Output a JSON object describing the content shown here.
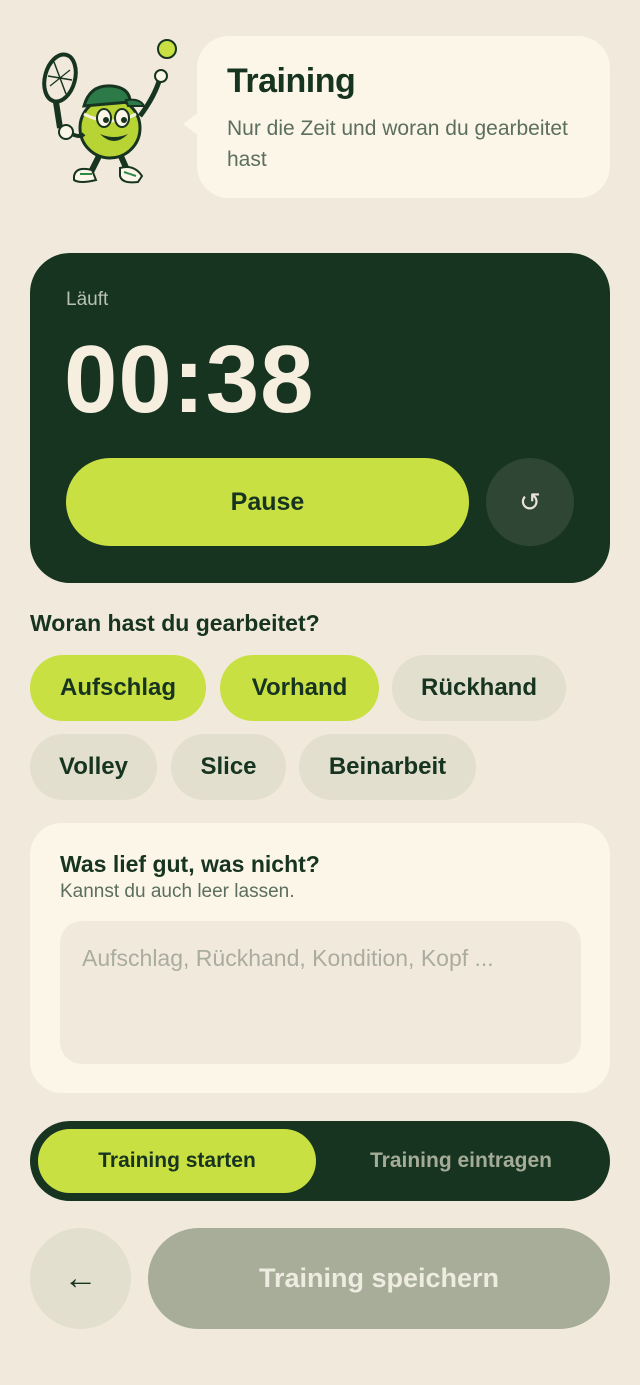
{
  "header": {
    "title": "Training",
    "subtitle": "Nur die Zeit und woran du gearbeitet hast",
    "mascot_icon": "tennis-ball-mascot-icon"
  },
  "timer": {
    "status": "Läuft",
    "time": "00:38",
    "pause_label": "Pause",
    "reset_icon": "↺"
  },
  "focus": {
    "question": "Woran hast du gearbeitet?",
    "chips": [
      {
        "label": "Aufschlag",
        "selected": true
      },
      {
        "label": "Vorhand",
        "selected": true
      },
      {
        "label": "Rückhand",
        "selected": false
      },
      {
        "label": "Volley",
        "selected": false
      },
      {
        "label": "Slice",
        "selected": false
      },
      {
        "label": "Beinarbeit",
        "selected": false
      }
    ]
  },
  "notes": {
    "title": "Was lief gut, was nicht?",
    "hint": "Kannst du auch leer lassen.",
    "placeholder": "Aufschlag, Rückhand, Kondition, Kopf ..."
  },
  "mode": {
    "options": [
      "Training starten",
      "Training eintragen"
    ],
    "selected": "Training starten"
  },
  "footer": {
    "back_icon": "←",
    "save_label": "Training speichern"
  },
  "colors": {
    "background": "#f1eadc",
    "dark_green": "#173420",
    "accent_lime": "#c9e043",
    "chip_idle": "#e2dfcf",
    "save_disabled": "#a7ad98"
  }
}
